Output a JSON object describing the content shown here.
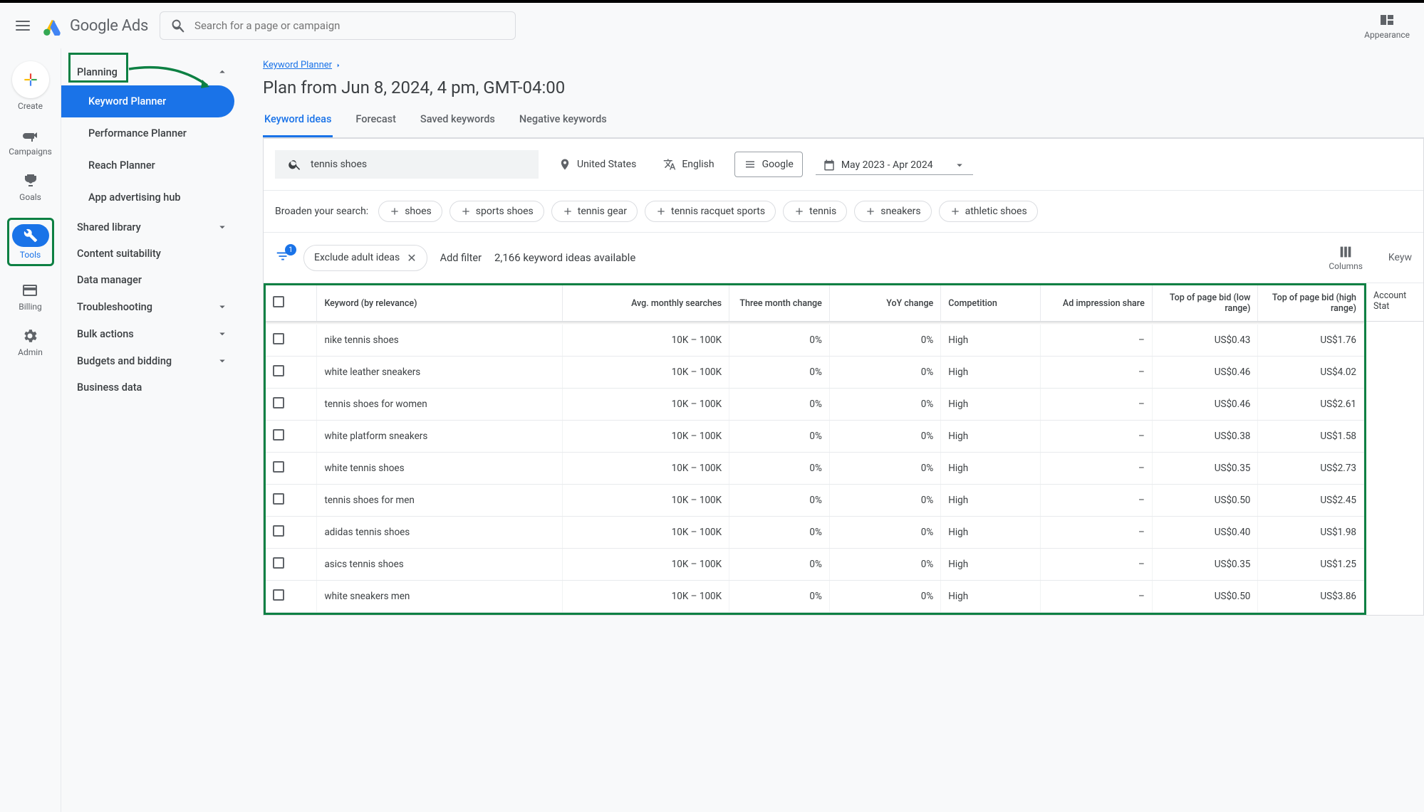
{
  "header": {
    "logo_text": "Google Ads",
    "search_placeholder": "Search for a page or campaign",
    "appearance_label": "Appearance"
  },
  "left_rail": {
    "create": "Create",
    "campaigns": "Campaigns",
    "goals": "Goals",
    "tools": "Tools",
    "billing": "Billing",
    "admin": "Admin"
  },
  "sidebar": {
    "planning": "Planning",
    "items": {
      "kw_planner": "Keyword Planner",
      "perf_planner": "Performance Planner",
      "reach_planner": "Reach Planner",
      "app_hub": "App advertising hub"
    },
    "shared_library": "Shared library",
    "content_suitability": "Content suitability",
    "data_manager": "Data manager",
    "troubleshooting": "Troubleshooting",
    "bulk_actions": "Bulk actions",
    "budgets": "Budgets and bidding",
    "business_data": "Business data"
  },
  "main": {
    "breadcrumb_kw": "Keyword Planner",
    "title": "Plan from Jun 8, 2024, 4 pm, GMT-04:00",
    "tabs": {
      "ideas": "Keyword ideas",
      "forecast": "Forecast",
      "saved": "Saved keywords",
      "negative": "Negative keywords"
    },
    "search_term": "tennis shoes",
    "location": "United States",
    "language": "English",
    "network": "Google",
    "date_range": "May 2023 - Apr 2024",
    "broaden_label": "Broaden your search:",
    "broaden_chips": [
      "shoes",
      "sports shoes",
      "tennis gear",
      "tennis racquet sports",
      "tennis",
      "sneakers",
      "athletic shoes"
    ],
    "filter_badge": "1",
    "exclude_label": "Exclude adult ideas",
    "add_filter": "Add filter",
    "ideas_available": "2,166 keyword ideas available",
    "columns_label": "Columns",
    "keyw_cut": "Keyw",
    "table_headers": {
      "keyword": "Keyword (by relevance)",
      "searches": "Avg. monthly searches",
      "three_month": "Three month change",
      "yoy": "YoY change",
      "competition": "Competition",
      "impression": "Ad impression share",
      "bid_low": "Top of page bid (low range)",
      "bid_high": "Top of page bid (high range)",
      "account": "Account Stat"
    },
    "rows": [
      {
        "kw": "nike tennis shoes",
        "searches": "10K – 100K",
        "tm": "0%",
        "yoy": "0%",
        "comp": "High",
        "imp": "–",
        "low": "US$0.43",
        "high": "US$1.76"
      },
      {
        "kw": "white leather sneakers",
        "searches": "10K – 100K",
        "tm": "0%",
        "yoy": "0%",
        "comp": "High",
        "imp": "–",
        "low": "US$0.46",
        "high": "US$4.02"
      },
      {
        "kw": "tennis shoes for women",
        "searches": "10K – 100K",
        "tm": "0%",
        "yoy": "0%",
        "comp": "High",
        "imp": "–",
        "low": "US$0.46",
        "high": "US$2.61"
      },
      {
        "kw": "white platform sneakers",
        "searches": "10K – 100K",
        "tm": "0%",
        "yoy": "0%",
        "comp": "High",
        "imp": "–",
        "low": "US$0.38",
        "high": "US$1.58"
      },
      {
        "kw": "white tennis shoes",
        "searches": "10K – 100K",
        "tm": "0%",
        "yoy": "0%",
        "comp": "High",
        "imp": "–",
        "low": "US$0.35",
        "high": "US$2.73"
      },
      {
        "kw": "tennis shoes for men",
        "searches": "10K – 100K",
        "tm": "0%",
        "yoy": "0%",
        "comp": "High",
        "imp": "–",
        "low": "US$0.50",
        "high": "US$2.45"
      },
      {
        "kw": "adidas tennis shoes",
        "searches": "10K – 100K",
        "tm": "0%",
        "yoy": "0%",
        "comp": "High",
        "imp": "–",
        "low": "US$0.40",
        "high": "US$1.98"
      },
      {
        "kw": "asics tennis shoes",
        "searches": "10K – 100K",
        "tm": "0%",
        "yoy": "0%",
        "comp": "High",
        "imp": "–",
        "low": "US$0.35",
        "high": "US$1.25"
      },
      {
        "kw": "white sneakers men",
        "searches": "10K – 100K",
        "tm": "0%",
        "yoy": "0%",
        "comp": "High",
        "imp": "–",
        "low": "US$0.50",
        "high": "US$3.86"
      }
    ]
  }
}
